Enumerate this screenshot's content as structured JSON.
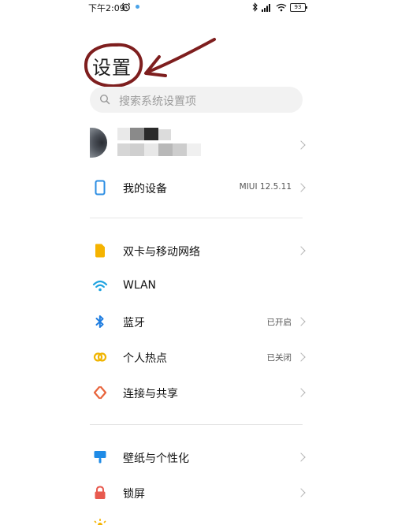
{
  "status_bar": {
    "time": "下午2:09",
    "battery": "93"
  },
  "header": {
    "title": "设置"
  },
  "search": {
    "placeholder": "搜索系统设置项"
  },
  "sections": [
    {
      "items": [
        {
          "label": "我的设备",
          "value": "MIUI 12.5.11",
          "icon": "phone-icon",
          "color": "#2b8de3"
        }
      ]
    },
    {
      "items": [
        {
          "label": "双卡与移动网络",
          "value": "",
          "icon": "sim-card-icon",
          "color": "#f5b300"
        },
        {
          "label": "WLAN",
          "value": "",
          "icon": "wifi-icon",
          "color": "#1fa3e0"
        },
        {
          "label": "蓝牙",
          "value": "已开启",
          "icon": "bluetooth-icon",
          "color": "#1f7de0"
        },
        {
          "label": "个人热点",
          "value": "已关闭",
          "icon": "hotspot-icon",
          "color": "#f0b400"
        },
        {
          "label": "连接与共享",
          "value": "",
          "icon": "connection-share-icon",
          "color": "#e8643c"
        }
      ]
    },
    {
      "items": [
        {
          "label": "壁纸与个性化",
          "value": "",
          "icon": "wallpaper-icon",
          "color": "#1f8be6"
        },
        {
          "label": "锁屏",
          "value": "",
          "icon": "lock-icon",
          "color": "#e85a4f"
        }
      ]
    }
  ]
}
